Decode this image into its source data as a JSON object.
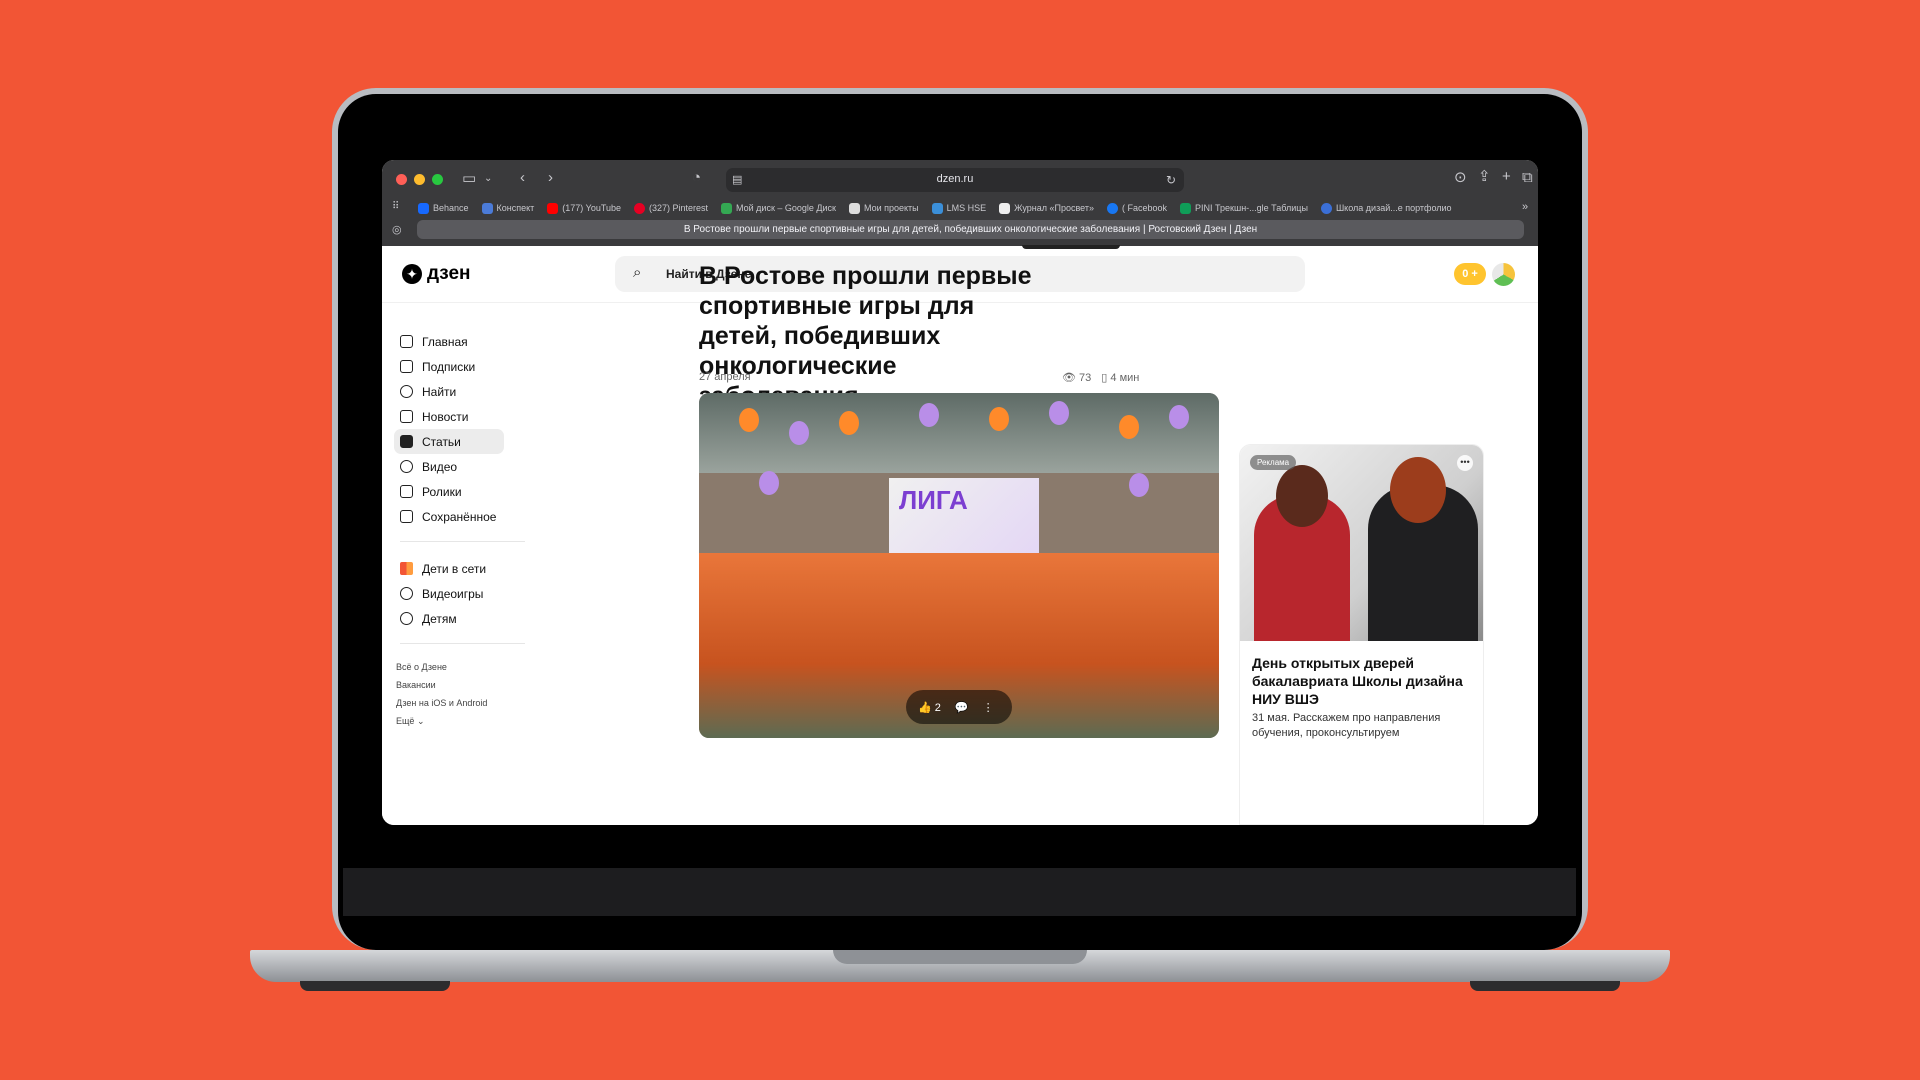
{
  "browser": {
    "url": "dzen.ru",
    "tab_title": "В Ростове прошли первые спортивные игры для детей, победивших онкологические заболевания | Ростовский Дзен | Дзен",
    "bookmarks": [
      "Behance",
      "Конспект",
      "(177) YouTube",
      "(327) Pinterest",
      "Мой диск – Google Диск",
      "Мои проекты",
      "LMS HSE",
      "Журнал «Просвет»",
      "( Facebook",
      "PINI Трекшн-...gle Таблицы",
      "Школа дизай...е портфолио"
    ],
    "colors": {
      "chrome": "#3a3a3c",
      "traffic_red": "#ff5f57",
      "traffic_yellow": "#febc2e",
      "traffic_green": "#28c840"
    }
  },
  "site": {
    "logo_text": "дзен",
    "search_placeholder": "Найти в Дзене",
    "coins": "0 +"
  },
  "sidebar": {
    "items": [
      {
        "label": "Главная",
        "icon": "home-icon"
      },
      {
        "label": "Подписки",
        "icon": "subscriptions-icon"
      },
      {
        "label": "Найти",
        "icon": "search-icon"
      },
      {
        "label": "Новости",
        "icon": "news-icon"
      },
      {
        "label": "Статьи",
        "icon": "articles-icon",
        "active": true
      },
      {
        "label": "Видео",
        "icon": "video-icon"
      },
      {
        "label": "Ролики",
        "icon": "shorts-icon"
      },
      {
        "label": "Сохранённое",
        "icon": "bookmark-icon"
      }
    ],
    "extra_items": [
      {
        "label": "Дети в сети",
        "icon": "kids-online-icon"
      },
      {
        "label": "Видеоигры",
        "icon": "gamepad-icon"
      },
      {
        "label": "Детям",
        "icon": "bear-icon"
      }
    ],
    "footer_links": [
      "Всё о Дзене",
      "Вакансии",
      "Дзен на iOS и Android",
      "Ещё"
    ]
  },
  "article": {
    "title": "В Ростове прошли первые спортивные игры для детей, победивших онкологические заболевания",
    "date": "27 апреля",
    "views": "73",
    "read_time": "4 мин",
    "likes": "2",
    "hero_sign": "ЛИГА"
  },
  "ad": {
    "badge": "Реклама",
    "title": "День открытых дверей бакалавриата Школы дизайна НИУ ВШЭ",
    "description": "31 мая. Расскажем про направления обучения, проконсультируем"
  }
}
